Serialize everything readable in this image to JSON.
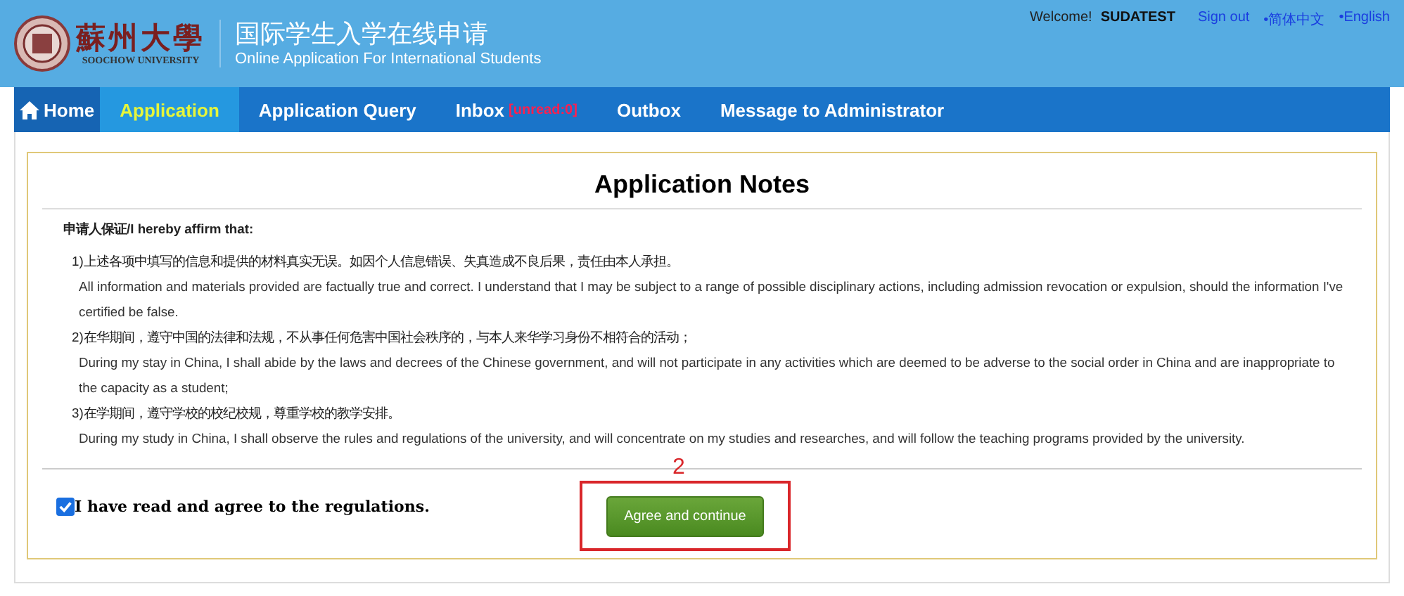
{
  "header": {
    "logo_cn": "蘇州大學",
    "logo_en": "SOOCHOW UNIVERSITY",
    "title_cn": "国际学生入学在线申请",
    "title_en": "Online Application For International Students",
    "welcome": "Welcome!",
    "user": "SUDATEST",
    "links": [
      "Sign out",
      "•简体中文",
      "•English"
    ]
  },
  "nav": [
    {
      "kind": "home",
      "label": "Home",
      "selected": false
    },
    {
      "kind": "plain",
      "label": "Application",
      "selected": true
    },
    {
      "kind": "plain",
      "label": "Application Query",
      "selected": false
    },
    {
      "kind": "plain",
      "label": "Inbox",
      "badge": "[unread:0]",
      "selected": false
    },
    {
      "kind": "plain",
      "label": "Outbox",
      "selected": false
    },
    {
      "kind": "plain",
      "label": "Message to Administrator",
      "selected": false
    }
  ],
  "notes": {
    "title": "Application Notes",
    "heading": "申请人保证/I hereby affirm that:",
    "items": [
      {
        "cn": "1)上述各项中填写的信息和提供的材料真实无误。如因个人信息错误、失真造成不良后果，责任由本人承担。",
        "en": "All information and materials provided are factually true and correct. I understand that I may be subject to a range of possible disciplinary actions, including admission revocation or expulsion, should the information I've certified be false."
      },
      {
        "cn": "2)在华期间，遵守中国的法律和法规，不从事任何危害中国社会秩序的，与本人来华学习身份不相符合的活动；",
        "en": "During my stay in China, I shall abide by the laws and decrees of the Chinese government, and will not participate in any activities which are deemed to be adverse to the social order in China and are inappropriate to the capacity as a student;"
      },
      {
        "cn": "3)在学期间，遵守学校的校纪校规，尊重学校的教学安排。",
        "en": "During my study in China, I shall observe the rules and regulations of the university, and will concentrate on my studies and researches, and will follow the teaching programs provided by the university."
      }
    ]
  },
  "agreement": {
    "label": "I have read and agree to the regulations.",
    "checked": true
  },
  "button": "Agree and continue",
  "annotation": "2"
}
